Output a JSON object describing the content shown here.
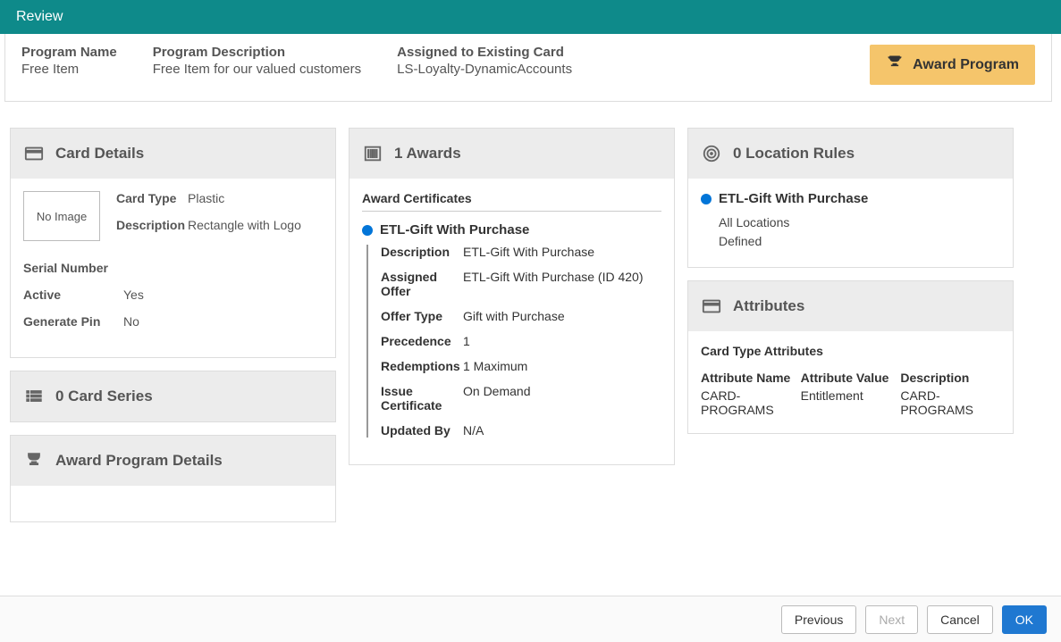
{
  "title": "Review",
  "header": {
    "program_name_label": "Program Name",
    "program_name_value": "Free Item",
    "program_desc_label": "Program Description",
    "program_desc_value": "Free Item for our valued customers",
    "assigned_card_label": "Assigned to Existing Card",
    "assigned_card_value": "LS-Loyalty-DynamicAccounts",
    "award_program_btn": "Award Program"
  },
  "card_details": {
    "panel_title": "Card Details",
    "no_image": "No Image",
    "card_type_label": "Card Type",
    "card_type_value": "Plastic",
    "description_label": "Description",
    "description_value": "Rectangle with Logo",
    "serial_label": "Serial Number",
    "serial_value": "",
    "active_label": "Active",
    "active_value": "Yes",
    "generate_pin_label": "Generate Pin",
    "generate_pin_value": "No"
  },
  "card_series": {
    "panel_title": "0 Card Series"
  },
  "award_program_details": {
    "panel_title": "Award Program Details"
  },
  "awards": {
    "panel_title": "1 Awards",
    "section_title": "Award Certificates",
    "item_name": "ETL-Gift With Purchase",
    "rows": {
      "description_label": "Description",
      "description_value": "ETL-Gift With Purchase",
      "assigned_offer_label": "Assigned Offer",
      "assigned_offer_value": "ETL-Gift With Purchase (ID 420)",
      "offer_type_label": "Offer Type",
      "offer_type_value": "Gift with Purchase",
      "precedence_label": "Precedence",
      "precedence_value": "1",
      "redemptions_label": "Redemptions",
      "redemptions_value": "1 Maximum",
      "issue_cert_label": "Issue Certificate",
      "issue_cert_value": "On Demand",
      "updated_by_label": "Updated By",
      "updated_by_value": "N/A"
    }
  },
  "location_rules": {
    "panel_title": "0 Location Rules",
    "item_name": "ETL-Gift With Purchase",
    "line1": "All Locations",
    "line2": "Defined"
  },
  "attributes": {
    "panel_title": "Attributes",
    "heading": "Card Type Attributes",
    "col1_header": "Attribute Name",
    "col1_value": "CARD-PROGRAMS",
    "col2_header": "Attribute Value",
    "col2_value": "Entitlement",
    "col3_header": "Description",
    "col3_value": "CARD-PROGRAMS"
  },
  "footer": {
    "previous": "Previous",
    "next": "Next",
    "cancel": "Cancel",
    "ok": "OK"
  }
}
